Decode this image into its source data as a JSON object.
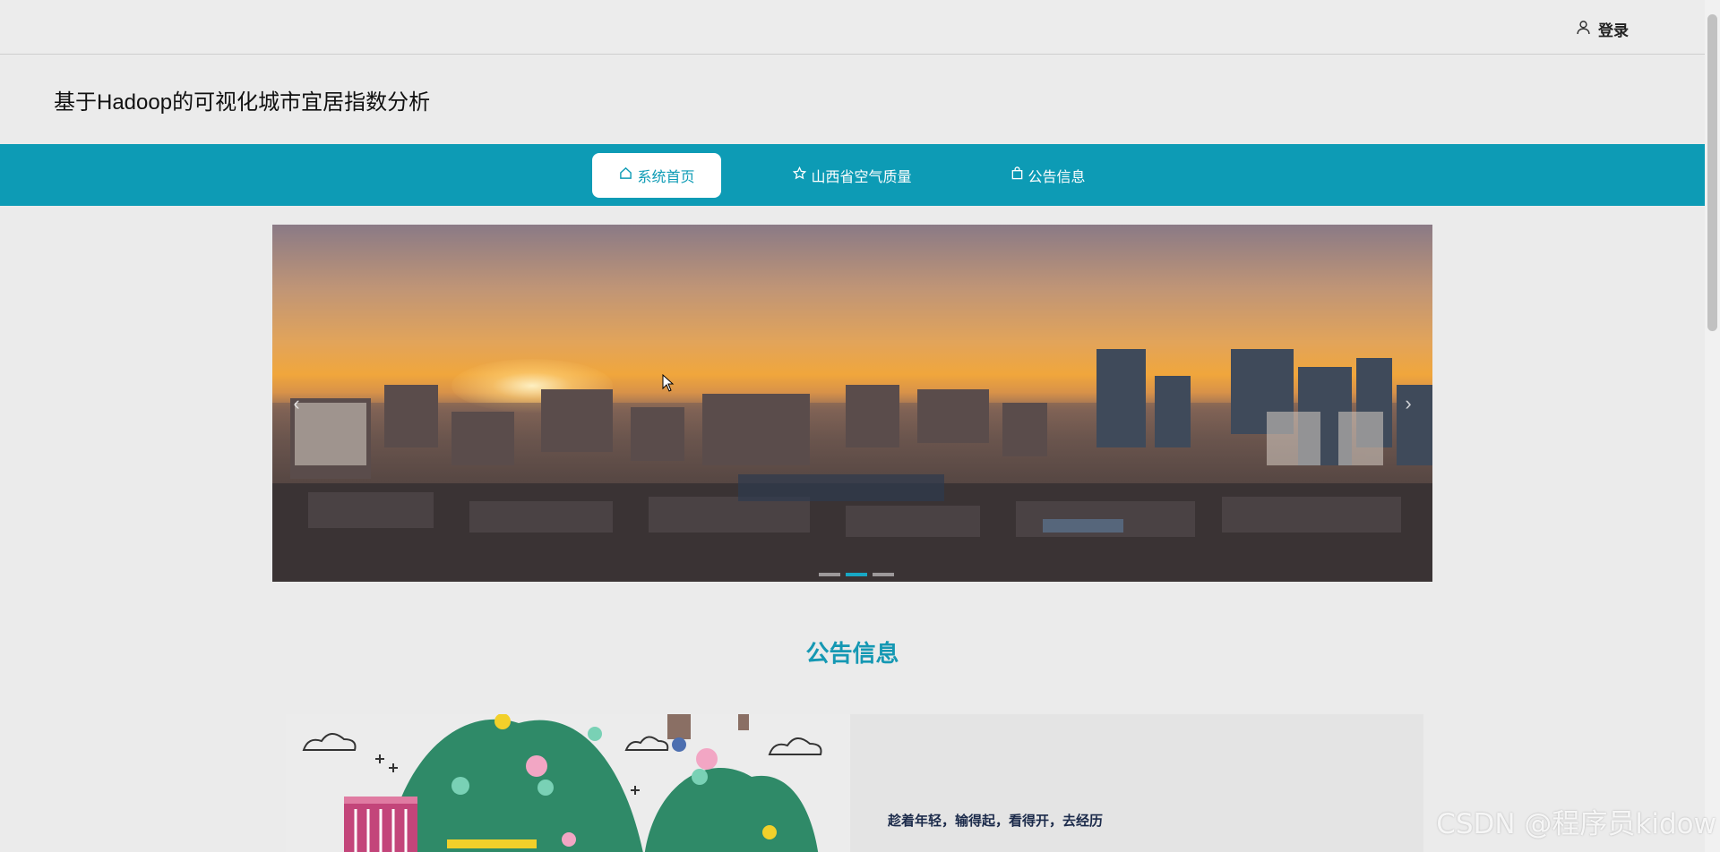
{
  "header": {
    "login_label": "登录",
    "site_title": "基于Hadoop的可视化城市宜居指数分析"
  },
  "nav": {
    "items": [
      {
        "label": "系统首页",
        "icon": "home-icon",
        "active": true
      },
      {
        "label": "山西省空气质量",
        "icon": "star-icon",
        "active": false
      },
      {
        "label": "公告信息",
        "icon": "bag-icon",
        "active": false
      }
    ]
  },
  "banner": {
    "prev_label": "‹",
    "next_label": "›",
    "slide_count": 3,
    "active_slide": 2
  },
  "section": {
    "title": "公告信息"
  },
  "notice": {
    "headline": "趁着年轻，输得起，看得开，去经历"
  },
  "watermark": "CSDN @程序员kidow",
  "colors": {
    "accent": "#0d9bb5",
    "title_accent": "#1598b3"
  }
}
